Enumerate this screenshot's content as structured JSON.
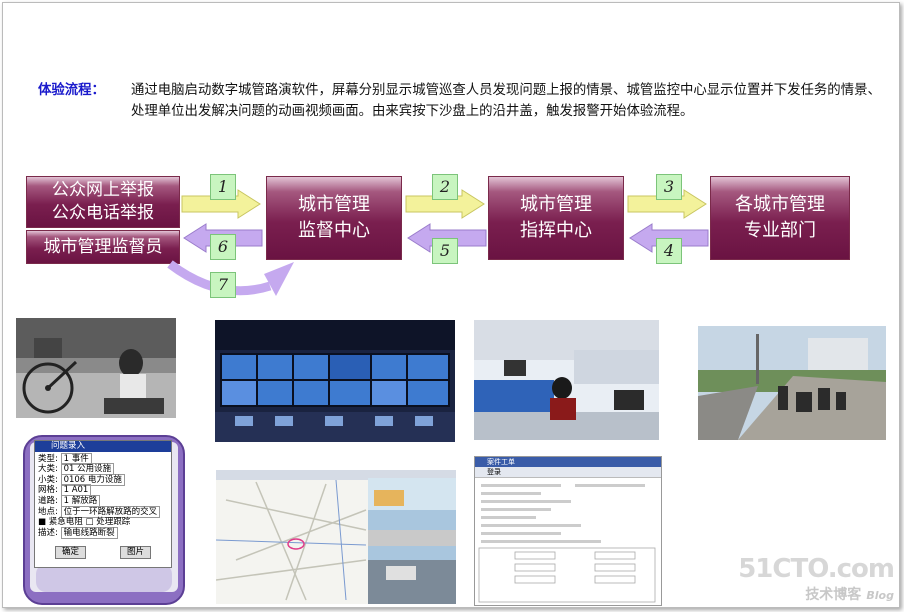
{
  "intro": {
    "label": "体验流程：",
    "text": "通过电脑启动数字城管路演软件，屏幕分别显示城管巡查人员发现问题上报的情景、城管监控中心显示位置并下发任务的情景、处理单位出发解决问题的动画视频画面。由来宾按下沙盘上的沿井盖，触发报警开始体验流程。"
  },
  "flow": {
    "public_reporting": [
      "公众网上举报",
      "公众电话举报"
    ],
    "supervisor": "城市管理监督员",
    "supervision_center": [
      "城市管理",
      "监督中心"
    ],
    "command_center": [
      "城市管理",
      "指挥中心"
    ],
    "departments": [
      "各城市管理",
      "专业部门"
    ],
    "steps": [
      "1",
      "2",
      "3",
      "4",
      "5",
      "6",
      "7"
    ]
  },
  "pda": {
    "title": "问题录入",
    "rows": [
      {
        "label": "类型:",
        "value": "1 事件"
      },
      {
        "label": "大类:",
        "value": "01 公用设施"
      },
      {
        "label": "小类:",
        "value": "0106 电力设施"
      },
      {
        "label": "网格:",
        "value": "1 A01"
      },
      {
        "label": "道路:",
        "value": "1 解放路"
      },
      {
        "label": "地点:",
        "value": "位于一环路解放路的交叉"
      }
    ],
    "check1": "紧急电阻",
    "check2": "处理跟踪",
    "desc_label": "描述:",
    "desc_value": "输电线路断裂",
    "ok": "确定",
    "photo": "图片"
  },
  "form_window": {
    "title": "案件工单",
    "tab": "登录"
  },
  "watermark": {
    "site": "51CTO.com",
    "sub": "技术博客",
    "blog": "Blog"
  },
  "colors": {
    "box": "#7a1f4f",
    "forward_arrow": "#f3f29b",
    "back_arrow": "#c5a9ef",
    "step_label": "#c8f5c0",
    "intro_label": "#1a1acc"
  }
}
